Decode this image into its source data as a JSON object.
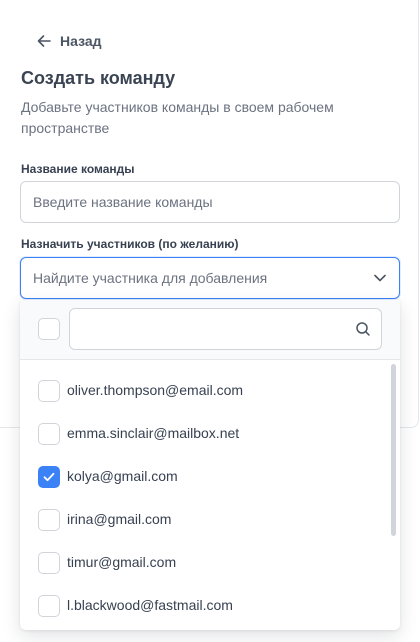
{
  "back": {
    "label": "Назад"
  },
  "title": "Создать команду",
  "description": "Добавьте участников команды в своем рабочем пространстве",
  "team_name": {
    "label": "Название команды",
    "placeholder": "Введите название команды",
    "value": ""
  },
  "members": {
    "label": "Назначить участников (по желанию)",
    "select_placeholder": "Найдите участника для добавления",
    "search_value": "",
    "select_all_checked": false,
    "items": [
      {
        "email": "oliver.thompson@email.com",
        "checked": false
      },
      {
        "email": "emma.sinclair@mailbox.net",
        "checked": false
      },
      {
        "email": "kolya@gmail.com",
        "checked": true
      },
      {
        "email": "irina@gmail.com",
        "checked": false
      },
      {
        "email": "timur@gmail.com",
        "checked": false
      },
      {
        "email": "l.blackwood@fastmail.com",
        "checked": false
      }
    ]
  },
  "icons": {
    "back": "arrow-left-icon",
    "select": "chevron-down-icon",
    "search": "search-icon",
    "check": "checkmark-icon"
  },
  "colors": {
    "accent": "#3b82f6",
    "border": "#d1d5db",
    "muted_text": "#6b7280"
  }
}
